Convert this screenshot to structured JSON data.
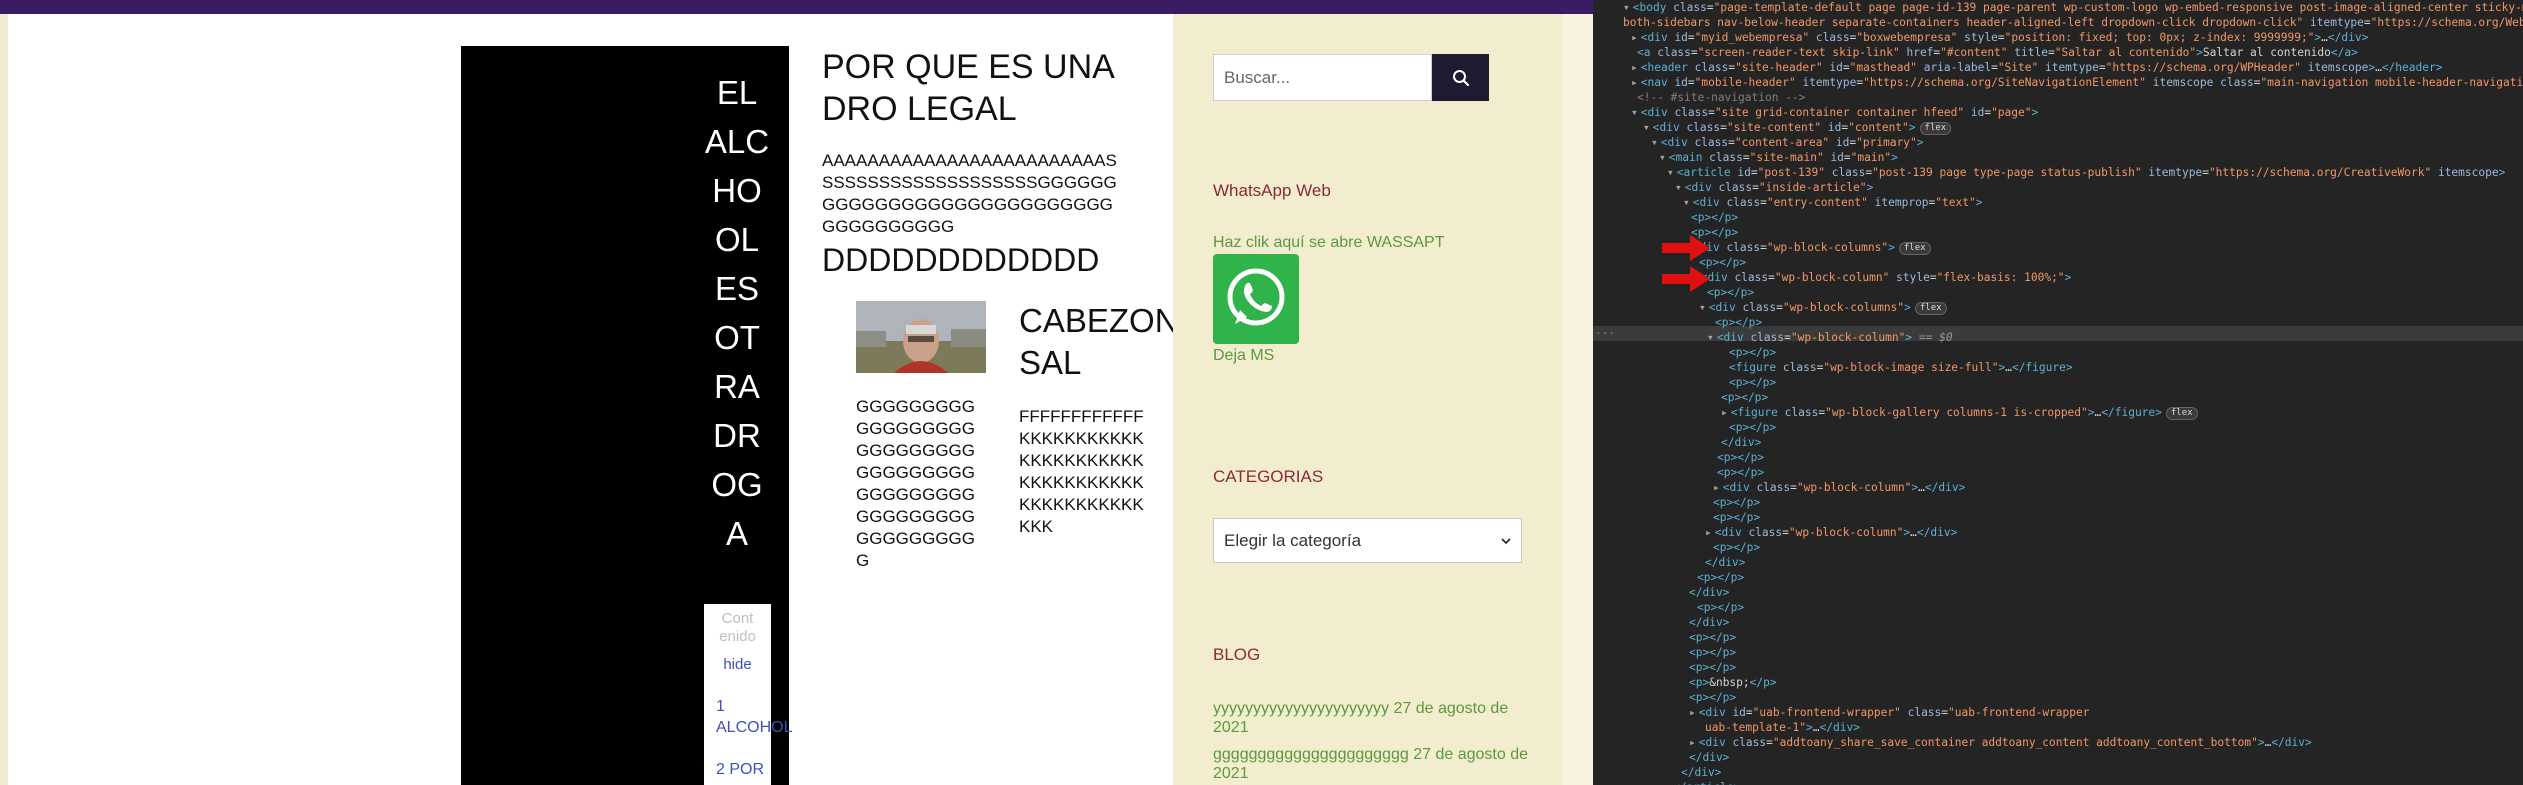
{
  "site": {
    "vertical_title": "EL ALCHOOLESOTRADROGA",
    "toc": {
      "title": "Cont enido",
      "hide_label": "hide",
      "item_1": "1 ALCOHOL",
      "item_2": "2 POR"
    },
    "heading_main": "POR QUE ES UNA DRO LEGAL",
    "a_lines": "AAAAAAAAAAAAAAAAAAAAAAAAASSSSSSSSSSSSSSSSSSSSGGGGGGGGGGGGGGGGGGGGGGGGGGGGGGGGGGGGGG",
    "d_line": "DDDDDDDDDDDD",
    "heading_cabez": "CABEZON SAL",
    "g_lines": "GGGGGGGGGGGGGGGGGGGGGGGGGGGGGGGGGGGGGGGGGGGGGGGGGGGGGGGGGGGGGGGG",
    "f_lines": "FFFFFFFFFFFFKKKKKKKKKKKKKKKKKKKKKKKKKKKKKKKKKKKKKKKKKKKKKKK"
  },
  "sidebar": {
    "search_placeholder": "Buscar...",
    "whatsapp_heading": "WhatsApp Web",
    "whatsapp_link": "Haz clik aquí se abre WASSAPT",
    "deja_ms": "Deja MS",
    "categories_heading": "CATEGORIAS",
    "category_select": "Elegir la categoría",
    "blog_heading": "BLOG",
    "blog_posts": [
      {
        "title": "yyyyyyyyyyyyyyyyyyyyyy",
        "date": "27 de agosto de 2021"
      },
      {
        "title": "gggggggggggggggggggggg",
        "date": "27 de agosto de 2021"
      }
    ]
  },
  "colors": {
    "topbar": "#3a1c63",
    "sidebar_bg": "#f3edcf",
    "heading_color": "#8a2a3a",
    "link_green": "#5a9a3a",
    "search_button": "#1f1a32",
    "whatsapp_green": "#2fb34a",
    "arrow_red": "#e01010"
  },
  "devtools": {
    "lines": [
      {
        "parts": [
          [
            "tri",
            "▾"
          ],
          [
            "tg",
            "<body "
          ],
          [
            "at",
            "class"
          ],
          [
            "tx",
            "="
          ],
          [
            "av",
            "\"page-template-default page page-id-139 page-parent wp-custom-logo wp-embed-responsive post-image-aligned-center sticky-menu"
          ]
        ]
      },
      {
        "parts": [
          [
            "av",
            "both-sidebars nav-below-header separate-containers header-aligned-left dropdown-click dropdown-click\" "
          ],
          [
            "at",
            "itemtype"
          ],
          [
            "tx",
            "="
          ],
          [
            "av",
            "\"https://schema.org/WebPage\""
          ]
        ]
      },
      {
        "parts": [
          [
            "tri",
            "▸"
          ],
          [
            "tg",
            "<div "
          ],
          [
            "at",
            "id"
          ],
          [
            "tx",
            "="
          ],
          [
            "av",
            "\"myid_webempresa\" "
          ],
          [
            "at",
            "class"
          ],
          [
            "tx",
            "="
          ],
          [
            "av",
            "\"boxwebempresa\" "
          ],
          [
            "at",
            "style"
          ],
          [
            "tx",
            "="
          ],
          [
            "av",
            "\"position: fixed; top: 0px; z-index: 9999999;\""
          ],
          [
            "tg",
            ">"
          ],
          [
            "tx",
            "…"
          ],
          [
            "tg",
            "</div>"
          ]
        ]
      },
      {
        "parts": [
          [
            "tg",
            "<a "
          ],
          [
            "at",
            "class"
          ],
          [
            "tx",
            "="
          ],
          [
            "av",
            "\"screen-reader-text skip-link\" "
          ],
          [
            "at",
            "href"
          ],
          [
            "tx",
            "="
          ],
          [
            "av",
            "\"#content\" "
          ],
          [
            "at",
            "title"
          ],
          [
            "tx",
            "="
          ],
          [
            "av",
            "\"Saltar al contenido\""
          ],
          [
            "tg",
            ">"
          ],
          [
            "tx",
            "Saltar al contenido"
          ],
          [
            "tg",
            "</a>"
          ]
        ]
      },
      {
        "parts": [
          [
            "tri",
            "▸"
          ],
          [
            "tg",
            "<header "
          ],
          [
            "at",
            "class"
          ],
          [
            "tx",
            "="
          ],
          [
            "av",
            "\"site-header\" "
          ],
          [
            "at",
            "id"
          ],
          [
            "tx",
            "="
          ],
          [
            "av",
            "\"masthead\" "
          ],
          [
            "at",
            "aria-label"
          ],
          [
            "tx",
            "="
          ],
          [
            "av",
            "\"Site\" "
          ],
          [
            "at",
            "itemtype"
          ],
          [
            "tx",
            "="
          ],
          [
            "av",
            "\"https://schema.org/WPHeader\" "
          ],
          [
            "at",
            "itemscope"
          ],
          [
            "tg",
            ">"
          ],
          [
            "tx",
            "…"
          ],
          [
            "tg",
            "</header>"
          ]
        ]
      },
      {
        "parts": [
          [
            "tri",
            "▸"
          ],
          [
            "tg",
            "<nav "
          ],
          [
            "at",
            "id"
          ],
          [
            "tx",
            "="
          ],
          [
            "av",
            "\"mobile-header\" "
          ],
          [
            "at",
            "itemtype"
          ],
          [
            "tx",
            "="
          ],
          [
            "av",
            "\"https://schema.org/SiteNavigationElement\" "
          ],
          [
            "at",
            "itemscope"
          ],
          [
            "tx",
            " "
          ],
          [
            "at",
            "class"
          ],
          [
            "tx",
            "="
          ],
          [
            "av",
            "\"main-navigation mobile-header-navigation s"
          ]
        ]
      },
      {
        "parts": [
          [
            "cm",
            "<!-- #site-navigation -->"
          ]
        ]
      },
      {
        "parts": [
          [
            "tri",
            "▾"
          ],
          [
            "tg",
            "<div "
          ],
          [
            "at",
            "class"
          ],
          [
            "tx",
            "="
          ],
          [
            "av",
            "\"site grid-container container hfeed\" "
          ],
          [
            "at",
            "id"
          ],
          [
            "tx",
            "="
          ],
          [
            "av",
            "\"page\""
          ],
          [
            "tg",
            ">"
          ]
        ]
      },
      {
        "parts": [
          [
            "tri",
            "▾"
          ],
          [
            "tg",
            "<div "
          ],
          [
            "at",
            "class"
          ],
          [
            "tx",
            "="
          ],
          [
            "av",
            "\"site-content\" "
          ],
          [
            "at",
            "id"
          ],
          [
            "tx",
            "="
          ],
          [
            "av",
            "\"content\""
          ],
          [
            "tg",
            ">"
          ]
        ],
        "badge": "flex"
      },
      {
        "parts": [
          [
            "tri",
            "▾"
          ],
          [
            "tg",
            "<div "
          ],
          [
            "at",
            "class"
          ],
          [
            "tx",
            "="
          ],
          [
            "av",
            "\"content-area\" "
          ],
          [
            "at",
            "id"
          ],
          [
            "tx",
            "="
          ],
          [
            "av",
            "\"primary\""
          ],
          [
            "tg",
            ">"
          ]
        ]
      },
      {
        "parts": [
          [
            "tri",
            "▾"
          ],
          [
            "tg",
            "<main "
          ],
          [
            "at",
            "class"
          ],
          [
            "tx",
            "="
          ],
          [
            "av",
            "\"site-main\" "
          ],
          [
            "at",
            "id"
          ],
          [
            "tx",
            "="
          ],
          [
            "av",
            "\"main\""
          ],
          [
            "tg",
            ">"
          ]
        ]
      },
      {
        "parts": [
          [
            "tri",
            "▾"
          ],
          [
            "tg",
            "<article "
          ],
          [
            "at",
            "id"
          ],
          [
            "tx",
            "="
          ],
          [
            "av",
            "\"post-139\" "
          ],
          [
            "at",
            "class"
          ],
          [
            "tx",
            "="
          ],
          [
            "av",
            "\"post-139 page type-page status-publish\" "
          ],
          [
            "at",
            "itemtype"
          ],
          [
            "tx",
            "="
          ],
          [
            "av",
            "\"https://schema.org/CreativeWork\" "
          ],
          [
            "at",
            "itemscope"
          ],
          [
            "tg",
            ">"
          ]
        ]
      },
      {
        "parts": [
          [
            "tri",
            "▾"
          ],
          [
            "tg",
            "<div "
          ],
          [
            "at",
            "class"
          ],
          [
            "tx",
            "="
          ],
          [
            "av",
            "\"inside-article\""
          ],
          [
            "tg",
            ">"
          ]
        ]
      },
      {
        "parts": [
          [
            "tri",
            "▾"
          ],
          [
            "tg",
            "<div "
          ],
          [
            "at",
            "class"
          ],
          [
            "tx",
            "="
          ],
          [
            "av",
            "\"entry-content\" "
          ],
          [
            "at",
            "itemprop"
          ],
          [
            "tx",
            "="
          ],
          [
            "av",
            "\"text\""
          ],
          [
            "tg",
            ">"
          ]
        ]
      },
      {
        "parts": [
          [
            "tg",
            "<p></p>"
          ]
        ]
      },
      {
        "parts": [
          [
            "tg",
            "<p></p>"
          ]
        ]
      },
      {
        "parts": [
          [
            "tri",
            "▾"
          ],
          [
            "tg",
            "<div "
          ],
          [
            "at",
            "class"
          ],
          [
            "tx",
            "="
          ],
          [
            "av",
            "\"wp-block-columns\""
          ],
          [
            "tg",
            ">"
          ]
        ],
        "badge": "flex"
      },
      {
        "parts": [
          [
            "tg",
            "<p></p>"
          ]
        ]
      },
      {
        "parts": [
          [
            "tri",
            "▾"
          ],
          [
            "tg",
            "<div "
          ],
          [
            "at",
            "class"
          ],
          [
            "tx",
            "="
          ],
          [
            "av",
            "\"wp-block-column\" "
          ],
          [
            "at",
            "style"
          ],
          [
            "tx",
            "="
          ],
          [
            "av",
            "\"flex-basis: 100%;\""
          ],
          [
            "tg",
            ">"
          ]
        ]
      },
      {
        "parts": [
          [
            "tg",
            "<p></p>"
          ]
        ]
      },
      {
        "parts": [
          [
            "tri",
            "▾"
          ],
          [
            "tg",
            "<div "
          ],
          [
            "at",
            "class"
          ],
          [
            "tx",
            "="
          ],
          [
            "av",
            "\"wp-block-columns\""
          ],
          [
            "tg",
            ">"
          ]
        ],
        "badge": "flex"
      },
      {
        "parts": [
          [
            "tg",
            "<p></p>"
          ]
        ]
      },
      {
        "parts": [
          [
            "tri",
            "▾"
          ],
          [
            "tg",
            "<div "
          ],
          [
            "at",
            "class"
          ],
          [
            "tx",
            "="
          ],
          [
            "av",
            "\"wp-block-column\""
          ],
          [
            "tg",
            ">"
          ],
          [
            "hint",
            " == $0"
          ]
        ]
      },
      {
        "parts": [
          [
            "tg",
            "<p></p>"
          ]
        ]
      },
      {
        "parts": [
          [
            "tg",
            "<figure "
          ],
          [
            "at",
            "class"
          ],
          [
            "tx",
            "="
          ],
          [
            "av",
            "\"wp-block-image size-full\""
          ],
          [
            "tg",
            ">"
          ],
          [
            "tx",
            "…"
          ],
          [
            "tg",
            "</figure>"
          ]
        ]
      },
      {
        "parts": [
          [
            "tg",
            "<p></p>"
          ]
        ]
      },
      {
        "parts": [
          [
            "tg",
            "<p></p>"
          ]
        ]
      },
      {
        "parts": [
          [
            "tri",
            "▸"
          ],
          [
            "tg",
            "<figure "
          ],
          [
            "at",
            "class"
          ],
          [
            "tx",
            "="
          ],
          [
            "av",
            "\"wp-block-gallery columns-1 is-cropped\""
          ],
          [
            "tg",
            ">"
          ],
          [
            "tx",
            "…"
          ],
          [
            "tg",
            "</figure>"
          ]
        ],
        "badge": "flex"
      },
      {
        "parts": [
          [
            "tg",
            "<p></p>"
          ]
        ]
      },
      {
        "parts": [
          [
            "tg",
            "</div>"
          ]
        ]
      },
      {
        "parts": [
          [
            "tg",
            "<p></p>"
          ]
        ]
      },
      {
        "parts": [
          [
            "tg",
            "<p></p>"
          ]
        ]
      },
      {
        "parts": [
          [
            "tri",
            "▸"
          ],
          [
            "tg",
            "<div "
          ],
          [
            "at",
            "class"
          ],
          [
            "tx",
            "="
          ],
          [
            "av",
            "\"wp-block-column\""
          ],
          [
            "tg",
            ">"
          ],
          [
            "tx",
            "…"
          ],
          [
            "tg",
            "</div>"
          ]
        ]
      },
      {
        "parts": [
          [
            "tg",
            "<p></p>"
          ]
        ]
      },
      {
        "parts": [
          [
            "tg",
            "<p></p>"
          ]
        ]
      },
      {
        "parts": [
          [
            "tri",
            "▸"
          ],
          [
            "tg",
            "<div "
          ],
          [
            "at",
            "class"
          ],
          [
            "tx",
            "="
          ],
          [
            "av",
            "\"wp-block-column\""
          ],
          [
            "tg",
            ">"
          ],
          [
            "tx",
            "…"
          ],
          [
            "tg",
            "</div>"
          ]
        ]
      },
      {
        "parts": [
          [
            "tg",
            "<p></p>"
          ]
        ]
      },
      {
        "parts": [
          [
            "tg",
            "</div>"
          ]
        ]
      },
      {
        "parts": [
          [
            "tg",
            "<p></p>"
          ]
        ]
      },
      {
        "parts": [
          [
            "tg",
            "</div>"
          ]
        ]
      },
      {
        "parts": [
          [
            "tg",
            "<p></p>"
          ]
        ]
      },
      {
        "parts": [
          [
            "tg",
            "</div>"
          ]
        ]
      },
      {
        "parts": [
          [
            "tg",
            "<p></p>"
          ]
        ]
      },
      {
        "parts": [
          [
            "tg",
            "<p></p>"
          ]
        ]
      },
      {
        "parts": [
          [
            "tg",
            "<p></p>"
          ]
        ]
      },
      {
        "parts": [
          [
            "tg",
            "<p>"
          ],
          [
            "tx",
            "&nbsp;"
          ],
          [
            "tg",
            "</p>"
          ]
        ]
      },
      {
        "parts": [
          [
            "tg",
            "<p></p>"
          ]
        ]
      },
      {
        "parts": [
          [
            "tri",
            "▸"
          ],
          [
            "tg",
            "<div "
          ],
          [
            "at",
            "id"
          ],
          [
            "tx",
            "="
          ],
          [
            "av",
            "\"uab-frontend-wrapper\" "
          ],
          [
            "at",
            "class"
          ],
          [
            "tx",
            "="
          ],
          [
            "av",
            "\"uab-frontend-wrapper"
          ]
        ]
      },
      {
        "parts": [
          [
            "av",
            "uab-template-1\""
          ],
          [
            "tg",
            ">"
          ],
          [
            "tx",
            "…"
          ],
          [
            "tg",
            "</div>"
          ]
        ]
      },
      {
        "parts": [
          [
            "tri",
            "▸"
          ],
          [
            "tg",
            "<div "
          ],
          [
            "at",
            "class"
          ],
          [
            "tx",
            "="
          ],
          [
            "av",
            "\"addtoany_share_save_container addtoany_content addtoany_content_bottom\""
          ],
          [
            "tg",
            ">"
          ],
          [
            "tx",
            "…"
          ],
          [
            "tg",
            "</div>"
          ]
        ]
      },
      {
        "parts": [
          [
            "tg",
            "</div>"
          ]
        ]
      },
      {
        "parts": [
          [
            "tg",
            "</div>"
          ]
        ]
      },
      {
        "parts": [
          [
            "tg",
            "</article>"
          ]
        ]
      }
    ]
  }
}
